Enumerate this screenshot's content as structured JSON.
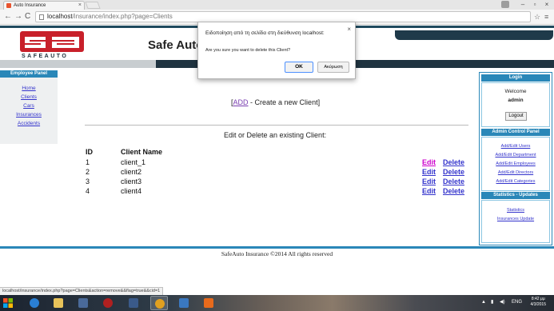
{
  "browser": {
    "tab_title": "Auto Insurance",
    "tab_close": "×",
    "url_host": "localhost",
    "url_path": "/insurance/index.php?page=Clients",
    "status_url": "localhost/insurance/index.php?page=Clients&action=remove&&flag=true&&cid=1"
  },
  "header": {
    "logo_text": "SAFEAUTO",
    "site_title": "Safe Auto"
  },
  "left_panel": {
    "title": "Employee Panel",
    "links": [
      "Home",
      "Clients",
      "Cars",
      "Insurances",
      "Accidents"
    ]
  },
  "main": {
    "create_prefix": "[",
    "create_link": "ADD",
    "create_suffix": " - Create a new Client]",
    "edit_heading": "Edit or Delete an existing Client:",
    "columns": [
      "ID",
      "Client Name"
    ],
    "rows": [
      {
        "id": "1",
        "name": "client_1",
        "edit": "Edit",
        "delete": "Delete"
      },
      {
        "id": "2",
        "name": "client2",
        "edit": "Edit",
        "delete": "Delete"
      },
      {
        "id": "3",
        "name": "client3",
        "edit": "Edit",
        "delete": "Delete"
      },
      {
        "id": "4",
        "name": "client4",
        "edit": "Edit",
        "delete": "Delete"
      }
    ]
  },
  "right_panel": {
    "login_title": "Login",
    "welcome": "Welcome",
    "username": "admin",
    "logout": "Logout",
    "admin_title": "Admin Control Panel",
    "admin_links": [
      "Add/Edit Users",
      "Add/Edit Department",
      "Add/Edit Employees",
      "Add/Edit Directors",
      "Add/Edit Categories"
    ],
    "stats_title": "Statistics - Updates",
    "stats_links": [
      "Statistics",
      "Insurances Update"
    ]
  },
  "footer": "SafeAuto Insurance ©2014 All rights reserved",
  "dialog": {
    "title": "Ειδοποίηση από τη σελίδα στη διεύθυνση localhost:",
    "close": "×",
    "message": "Are you sure you want to delete this Client?",
    "ok": "OK",
    "cancel": "Ακύρωση"
  },
  "taskbar": {
    "language": "ENG",
    "time": "8:42 μμ",
    "date": "4/3/2015"
  },
  "colors": {
    "panel_blue": "#2a87b8",
    "link_blue": "#3333cc",
    "visited_purple": "#7a3fb0",
    "edit_magenta": "#cc00cc",
    "logo_red": "#c8202a"
  }
}
